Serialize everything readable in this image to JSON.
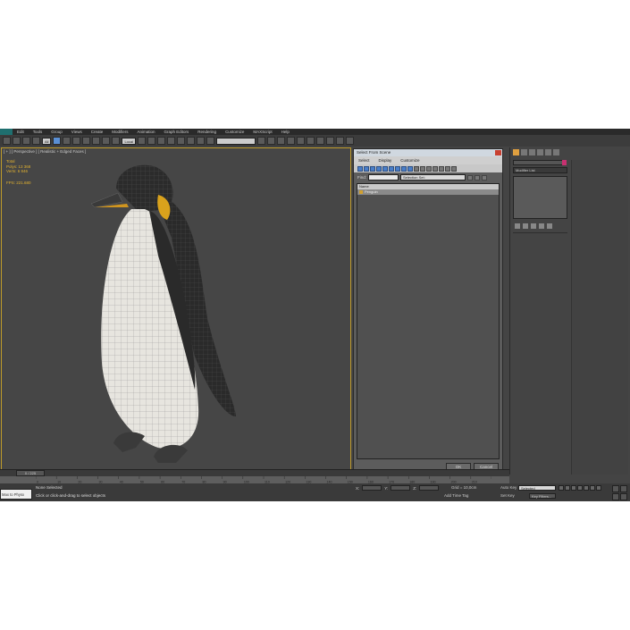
{
  "menu": [
    "Edit",
    "Tools",
    "Group",
    "Views",
    "Create",
    "Modifiers",
    "Animation",
    "Graph Editors",
    "Rendering",
    "Customize",
    "MAXScript",
    "Help"
  ],
  "toolbar": {
    "filter_value": "All",
    "ref_coord": "Local",
    "selection_set": ""
  },
  "viewport": {
    "label": "[ + ] [ Perspective ] [ Realistic + Edged Faces ]",
    "stats_total": "Total",
    "stats_polys": "Polys:   13 368",
    "stats_verts": "Verts:    6 846",
    "fps": "FPS:      221.680"
  },
  "dialog": {
    "title": "Select From Scene",
    "menu": [
      "Select",
      "Display",
      "Customize"
    ],
    "find_label": "Find:",
    "selection_set_label": "Selection Set:",
    "list_header": "Name",
    "items": [
      "Penguin"
    ],
    "ok_label": "OK",
    "cancel_label": "Cancel"
  },
  "command_panel": {
    "modifier_list": "Modifier List",
    "accent_color": "#c83070"
  },
  "timeline": {
    "frame": "0 / 225",
    "ticks": [
      "0",
      "10",
      "20",
      "30",
      "40",
      "50",
      "60",
      "70",
      "80",
      "90",
      "100",
      "110",
      "120",
      "130",
      "140",
      "150",
      "160",
      "170",
      "180",
      "190",
      "200",
      "210",
      "220"
    ]
  },
  "status": {
    "maxscript": "Max to Physx",
    "selection": "None Selected",
    "hint": "Click or click-and-drag to select objects",
    "x_label": "X:",
    "y_label": "Y:",
    "z_label": "Z:",
    "grid": "Grid = 10,0cm",
    "add_time_tag": "Add Time Tag",
    "auto_key": "Auto Key",
    "auto_key_value": "Selected",
    "set_key": "Set Key",
    "key_filters": "Key Filters..."
  }
}
